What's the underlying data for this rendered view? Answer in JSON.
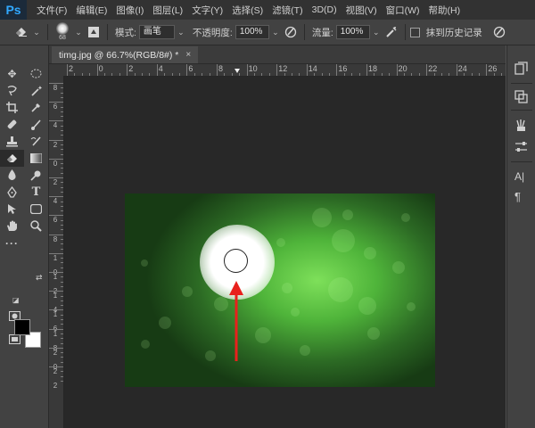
{
  "app": {
    "logo": "Ps"
  },
  "menu": [
    "文件(F)",
    "编辑(E)",
    "图像(I)",
    "图层(L)",
    "文字(Y)",
    "选择(S)",
    "滤镜(T)",
    "3D(D)",
    "视图(V)",
    "窗口(W)",
    "帮助(H)"
  ],
  "options_bar": {
    "tool_icon": "eraser-icon",
    "brush_size": "68",
    "mode_label": "模式:",
    "mode_value": "画笔",
    "opacity_label": "不透明度:",
    "opacity_value": "100%",
    "flow_label": "流量:",
    "flow_value": "100%",
    "history_label": "抹到历史记录"
  },
  "document": {
    "tab_title": "timg.jpg @ 66.7%(RGB/8#) *",
    "close_glyph": "×"
  },
  "ruler": {
    "horizontal_labels": [
      "2",
      "0",
      "2",
      "4",
      "6",
      "8",
      "10",
      "12",
      "14",
      "16",
      "18",
      "20",
      "22",
      "24",
      "26"
    ],
    "vertical_labels": [
      "8",
      "6",
      "4",
      "2",
      "0",
      "2",
      "4",
      "6",
      "8",
      "1 0",
      "1 2",
      "1 4",
      "1 6",
      "1 8",
      "2 0",
      "2 2"
    ]
  },
  "colors": {
    "foreground": "#000000",
    "background": "#ffffff",
    "annotation_arrow": "#e8211d",
    "ps_blue": "#31a8ff"
  },
  "right_dock_icons": [
    "history-icon",
    "channels-icon",
    "brushes-icon",
    "adjustments-icon",
    "character-icon",
    "paragraph-icon"
  ],
  "tools": [
    "move-icon",
    "marquee-icon",
    "lasso-icon",
    "magic-wand-icon",
    "crop-icon",
    "eyedropper-icon",
    "healing-icon",
    "brush-icon",
    "stamp-icon",
    "history-brush-icon",
    "eraser-icon",
    "gradient-icon",
    "blur-icon",
    "dodge-icon",
    "pen-icon",
    "type-icon",
    "path-select-icon",
    "shape-icon",
    "hand-icon",
    "zoom-icon",
    "more-icon"
  ]
}
